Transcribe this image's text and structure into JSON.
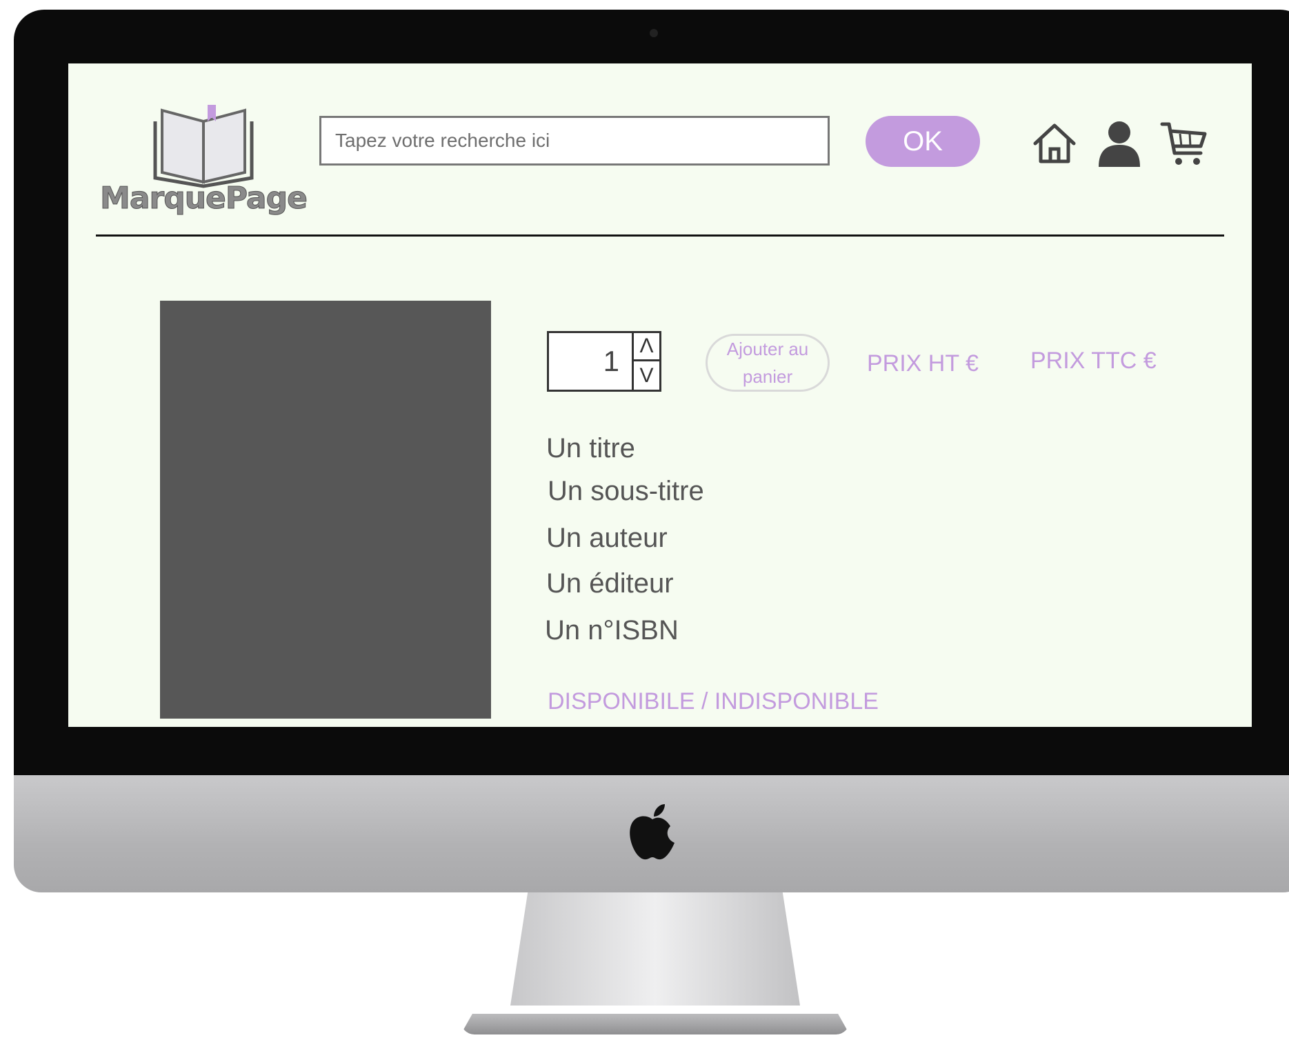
{
  "header": {
    "logo_text": "MarquePage",
    "search": {
      "placeholder": "Tapez votre recherche ici",
      "value": ""
    },
    "ok_label": "OK",
    "icons": [
      "home-icon",
      "user-icon",
      "cart-icon"
    ]
  },
  "product": {
    "quantity": "1",
    "qty_up_label": "Λ",
    "qty_down_label": "V",
    "add_to_cart_label": "Ajouter au panier",
    "price_ht": "PRIX HT €",
    "price_ttc": "PRIX TTC €",
    "title": "Un titre",
    "subtitle": "Un sous-titre",
    "author": "Un auteur",
    "publisher": "Un éditeur",
    "isbn": "Un n°ISBN",
    "availability": "DISPONIBILE / INDISPONIBLE"
  },
  "colors": {
    "accent": "#c39bde",
    "screen_background": "#f6fcf1",
    "cover_placeholder": "#575757",
    "text": "#555555"
  }
}
